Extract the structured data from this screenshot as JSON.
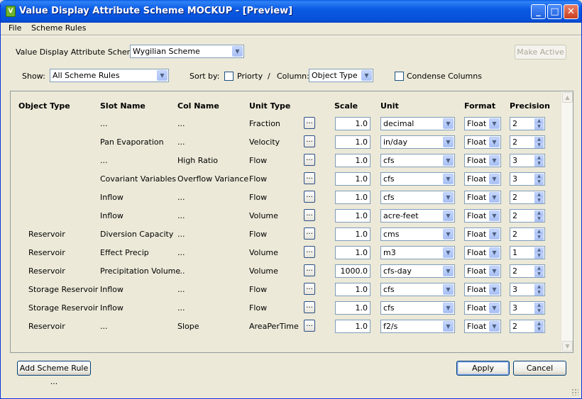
{
  "window": {
    "title": "Value Display Attribute Scheme MOCKUP - [Preview]",
    "icon": "app-icon",
    "icon_glyph": "V",
    "accent": "#0550d8",
    "min_glyph": "_",
    "max_glyph": "□",
    "close_glyph": "✕"
  },
  "menu": [
    "File",
    "Scheme Rules"
  ],
  "toolbar": {
    "scheme_label": "Value Display Attribute Scheme:",
    "scheme_value": "Wygilian Scheme",
    "make_active": "Make Active",
    "show_label": "Show:",
    "show_value": "All Scheme Rules",
    "sort_label": "Sort by:",
    "priority_label": "Priorty",
    "priority_checked": false,
    "slash": "/",
    "column_label": "Column:",
    "column_value": "Object Type",
    "condense_label": "Condense Columns",
    "condense_checked": false
  },
  "table": {
    "headers": [
      "Object Type",
      "Slot Name",
      "Col Name",
      "Unit Type",
      "Scale",
      "Unit",
      "Format",
      "Precision"
    ],
    "dots_label": "...",
    "rows": [
      {
        "object_type": "",
        "slot": "...",
        "col": "...",
        "unit_type": "Fraction",
        "scale": "1.0",
        "unit": "decimal",
        "format": "Float",
        "precision": "2"
      },
      {
        "object_type": "",
        "slot": "Pan Evaporation",
        "col": "...",
        "unit_type": "Velocity",
        "scale": "1.0",
        "unit": "in/day",
        "format": "Float",
        "precision": "2"
      },
      {
        "object_type": "",
        "slot": "...",
        "col": "High Ratio",
        "unit_type": "Flow",
        "scale": "1.0",
        "unit": "cfs",
        "format": "Float",
        "precision": "3"
      },
      {
        "object_type": "",
        "slot": "Covariant Variables",
        "col": "Overflow Variance",
        "unit_type": "Flow",
        "scale": "1.0",
        "unit": "cfs",
        "format": "Float",
        "precision": "3"
      },
      {
        "object_type": "",
        "slot": "Inflow",
        "col": "...",
        "unit_type": "Flow",
        "scale": "1.0",
        "unit": "cfs",
        "format": "Float",
        "precision": "2"
      },
      {
        "object_type": "",
        "slot": "Inflow",
        "col": "...",
        "unit_type": "Volume",
        "scale": "1.0",
        "unit": "acre-feet",
        "format": "Float",
        "precision": "2"
      },
      {
        "object_type": "Reservoir",
        "slot": "Diversion Capacity",
        "col": "...",
        "unit_type": "Flow",
        "scale": "1.0",
        "unit": "cms",
        "format": "Float",
        "precision": "2"
      },
      {
        "object_type": "Reservoir",
        "slot": "Effect Precip",
        "col": "...",
        "unit_type": "Volume",
        "scale": "1.0",
        "unit": "m3",
        "format": "Float",
        "precision": "1"
      },
      {
        "object_type": "Reservoir",
        "slot": "Precipitation Volume",
        "col": "...",
        "unit_type": "Volume",
        "scale": "1000.0",
        "unit": "cfs-day",
        "format": "Float",
        "precision": "2"
      },
      {
        "object_type": "Storage Reservoir",
        "slot": "Inflow",
        "col": "...",
        "unit_type": "Flow",
        "scale": "1.0",
        "unit": "cfs",
        "format": "Float",
        "precision": "3"
      },
      {
        "object_type": "Storage Reservoir",
        "slot": "Inflow",
        "col": "...",
        "unit_type": "Flow",
        "scale": "1.0",
        "unit": "cfs",
        "format": "Float",
        "precision": "3"
      },
      {
        "object_type": "Reservoir",
        "slot": "...",
        "col": "Slope",
        "unit_type": "AreaPerTime",
        "scale": "1.0",
        "unit": "f2/s",
        "format": "Float",
        "precision": "2"
      }
    ]
  },
  "footer": {
    "add_rule": "Add Scheme Rule ...",
    "apply": "Apply",
    "cancel": "Cancel"
  }
}
